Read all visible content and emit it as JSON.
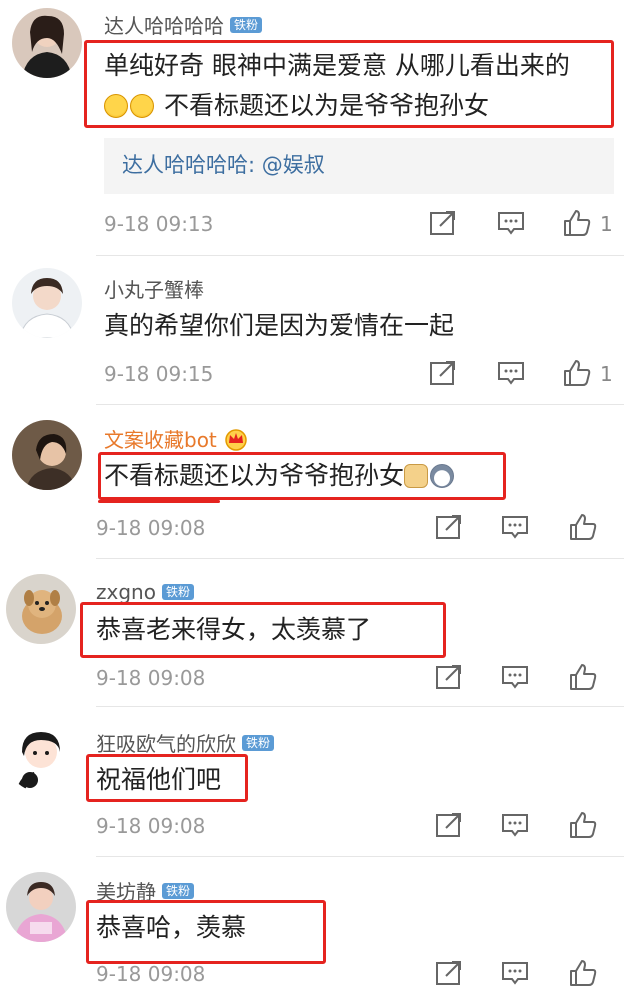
{
  "colors": {
    "highlight": "#e5231f",
    "reply_link": "#3d6ea0",
    "vip_name": "#e8792b",
    "badge": "#5b9bd5"
  },
  "comments": [
    {
      "username": "达人哈哈哈哈",
      "badge": "铁粉",
      "text_line1": "单纯好奇 眼神中满是爱意 从哪儿看出来的",
      "text_line2": "不看标题还以为是爷爷抱孙女",
      "emoji_icons": [
        "tears-of-joy-emoji",
        "tears-of-joy-emoji"
      ],
      "reply": {
        "user": "达人哈哈哈哈",
        "sep": ":",
        "mention": "@娱叔"
      },
      "time": "9-18 09:13",
      "likes": "1"
    },
    {
      "username": "小丸子蟹棒",
      "text": "真的希望你们是因为爱情在一起",
      "time": "9-18 09:15",
      "likes": "1"
    },
    {
      "username": "文案收藏bot",
      "text": "不看标题还以为爷爷抱孙女",
      "emoji_icons": [
        "doge-emoji",
        "husky-emoji"
      ],
      "time": "9-18 09:08"
    },
    {
      "username": "zxgno",
      "badge": "铁粉",
      "text": "恭喜老来得女，太羡慕了",
      "time": "9-18 09:08"
    },
    {
      "username": "狂吸欧气的欣欣",
      "badge": "铁粉",
      "text": "祝福他们吧",
      "time": "9-18 09:08"
    },
    {
      "username": "美坊静",
      "badge": "铁粉",
      "text": "恭喜哈，羡慕",
      "time": "9-18 09:08"
    }
  ]
}
